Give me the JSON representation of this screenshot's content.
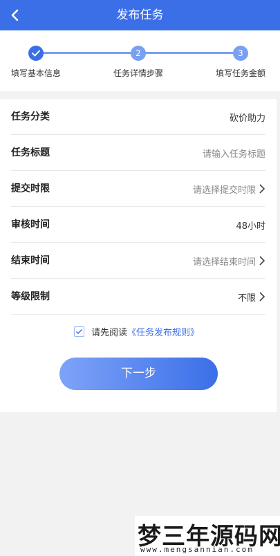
{
  "header": {
    "title": "发布任务",
    "back_icon": "chevron-left-icon"
  },
  "steps": [
    {
      "number": "",
      "label": "填写基本信息",
      "state": "done"
    },
    {
      "number": "2",
      "label": "任务详情步骤",
      "state": "todo"
    },
    {
      "number": "3",
      "label": "填写任务金额",
      "state": "todo"
    }
  ],
  "form": {
    "category": {
      "label": "任务分类",
      "value": "砍价助力"
    },
    "title": {
      "label": "任务标题",
      "placeholder": "请输入任务标题"
    },
    "deadline": {
      "label": "提交时限",
      "value": "请选择提交时限"
    },
    "review": {
      "label": "审核时间",
      "value": "48小时"
    },
    "end_time": {
      "label": "结束时间",
      "value": "请选择结束时间"
    },
    "level": {
      "label": "等级限制",
      "value": "不限"
    }
  },
  "agreement": {
    "checked": true,
    "prefix": "请先阅读",
    "link": "《任务发布规则》"
  },
  "next_button": "下一步",
  "watermark": {
    "main": "梦三年源码网",
    "sub": "www.mengsannian.com"
  },
  "colors": {
    "primary": "#3b6fe8",
    "step_light": "#7aa0f2",
    "background": "#f2f2f2"
  }
}
